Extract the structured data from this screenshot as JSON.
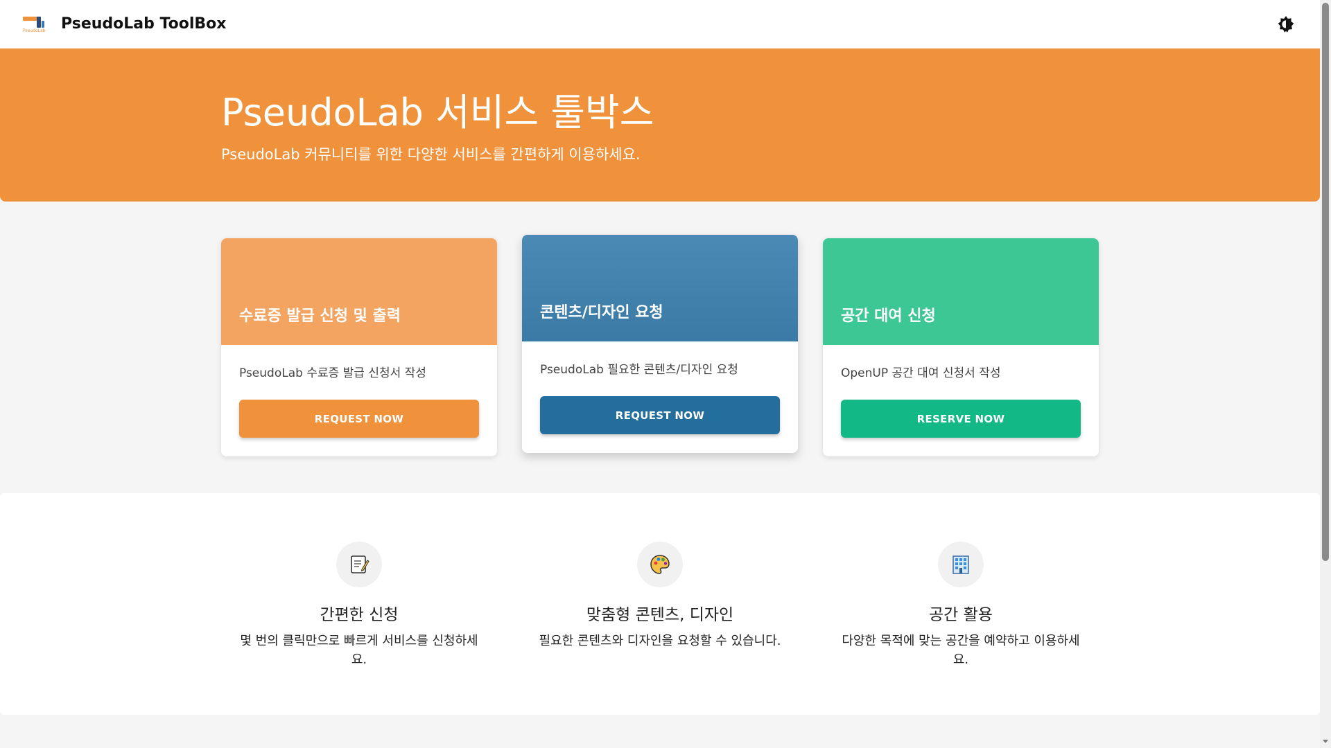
{
  "header": {
    "brand": "PseudoLab ToolBox",
    "logo_text": "PseudoLab",
    "theme_toggle_icon": "brightness-icon"
  },
  "hero": {
    "title": "PseudoLab 서비스 툴박스",
    "subtitle": "PseudoLab 커뮤니티를 위한 다양한 서비스를 간편하게 이용하세요."
  },
  "cards": [
    {
      "title": "수료증 발급 신청 및 출력",
      "description": "PseudoLab 수료증 발급 신청서 작성",
      "button": "REQUEST NOW",
      "color": "#f0923b"
    },
    {
      "title": "콘텐츠/디자인 요청",
      "description": "PseudoLab 필요한 콘텐츠/디자인 요청",
      "button": "REQUEST NOW",
      "color": "#246e9e"
    },
    {
      "title": "공간 대여 신청",
      "description": "OpenUP 공간 대여 신청서 작성",
      "button": "RESERVE NOW",
      "color": "#12b886"
    }
  ],
  "features": [
    {
      "icon": "memo-icon",
      "title": "간편한 신청",
      "description": "몇 번의 클릭만으로 빠르게 서비스를 신청하세요."
    },
    {
      "icon": "palette-icon",
      "title": "맞춤형 콘텐츠, 디자인",
      "description": "필요한 콘텐츠와 디자인을 요청할 수 있습니다."
    },
    {
      "icon": "building-icon",
      "title": "공간 활용",
      "description": "다양한 목적에 맞는 공간을 예약하고 이용하세요."
    }
  ]
}
